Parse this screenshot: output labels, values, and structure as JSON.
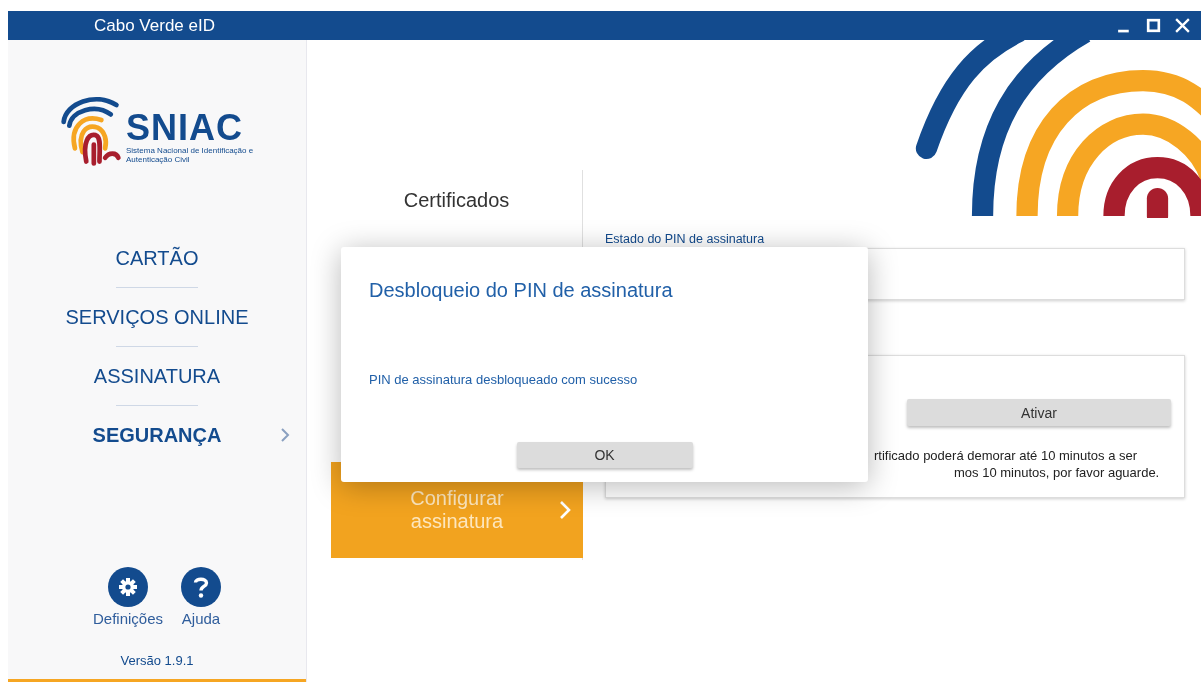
{
  "window": {
    "title": "Cabo Verde eID"
  },
  "logo": {
    "name": "SNIAC",
    "subtitle": "Sistema Nacional de Identificação e Autenticação Civil"
  },
  "nav": [
    {
      "label": "CARTÃO",
      "selected": false
    },
    {
      "label": "SERVIÇOS ONLINE",
      "selected": false
    },
    {
      "label": "ASSINATURA",
      "selected": false
    },
    {
      "label": "SEGURANÇA",
      "selected": true
    }
  ],
  "footer": {
    "links": [
      {
        "kind": "settings",
        "label": "Definições"
      },
      {
        "kind": "help",
        "label": "Ajuda"
      }
    ],
    "version": "Versão 1.9.1"
  },
  "submenu": [
    {
      "label": "Certificados",
      "selected": false
    },
    {
      "label": "Configurar assinatura",
      "selected": true
    }
  ],
  "pin_status": {
    "label": "Estado do PIN de assinatura"
  },
  "activation": {
    "button": "Ativar",
    "note_lines": [
      "rtificado poderá demorar até 10 minutos a ser",
      "mos 10 minutos, por favor aguarde."
    ]
  },
  "dialog": {
    "title": "Desbloqueio do PIN de assinatura",
    "message": "PIN de assinatura desbloqueado com sucesso",
    "button": "OK"
  }
}
